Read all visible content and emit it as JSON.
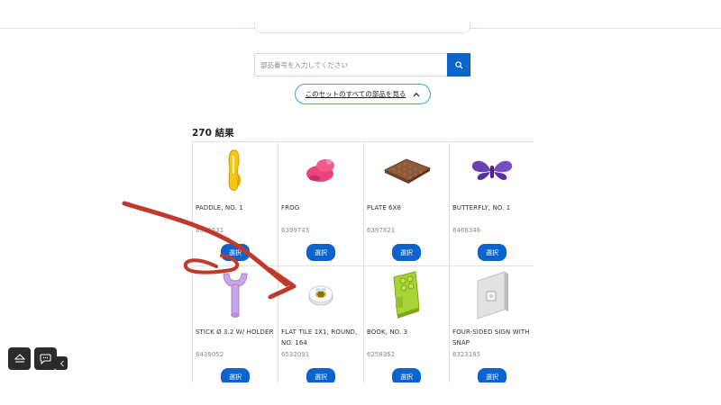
{
  "search": {
    "placeholder": "部品番号を入力してください"
  },
  "toggle": {
    "label": "このセットのすべての部品を見る"
  },
  "results": {
    "count_label": "270 結果"
  },
  "parts": [
    {
      "name": "PADDLE, NO. 1",
      "number": "6386531",
      "button": "選択",
      "icon": "yellow-paddle-icon"
    },
    {
      "name": "FROG",
      "number": "6399743",
      "button": "選択",
      "icon": "pink-frog-icon"
    },
    {
      "name": "PLATE 6X8",
      "number": "6397821",
      "button": "選択",
      "icon": "brown-plate-icon"
    },
    {
      "name": "BUTTERFLY, NO. 1",
      "number": "6468346",
      "button": "選択",
      "icon": "purple-butterfly-icon"
    },
    {
      "name": "STICK Ø 3.2 W/ HOLDER",
      "number": "6439052",
      "button": "選択",
      "icon": "lavender-stick-icon"
    },
    {
      "name": "FLAT TILE 1X1, ROUND, NO. 164",
      "number": "6532091",
      "button": "選択",
      "icon": "bee-tile-icon"
    },
    {
      "name": "BOOK, NO. 3",
      "number": "6258352",
      "button": "選択",
      "icon": "green-book-icon"
    },
    {
      "name": "FOUR-SIDED SIGN WITH SNAP",
      "number": "6323185",
      "button": "選択",
      "icon": "grey-sign-icon"
    }
  ],
  "colors": {
    "accent": "#0b63ce",
    "toggle_border": "#27b3cf",
    "annotation": "#c0392b"
  }
}
